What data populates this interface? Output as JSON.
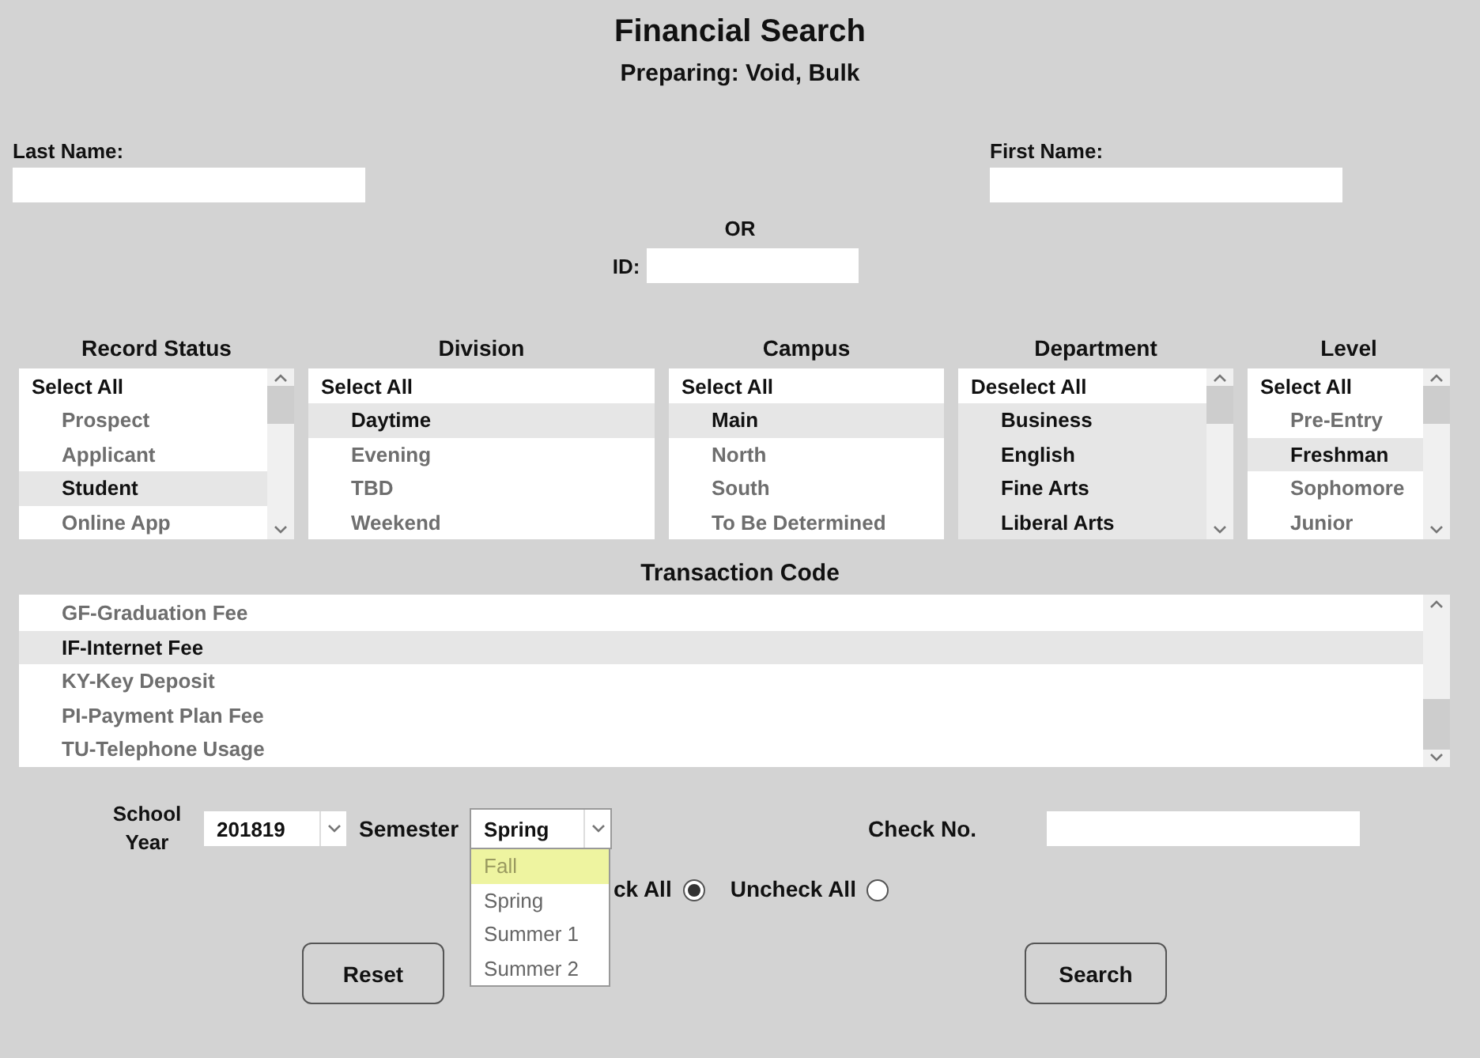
{
  "title": "Financial Search",
  "subtitle": "Preparing: Void, Bulk",
  "last_name": {
    "label": "Last Name:"
  },
  "first_name": {
    "label": "First Name:"
  },
  "or_label": "OR",
  "id_field": {
    "label": "ID:"
  },
  "filters": [
    {
      "heading": "Record Status",
      "header_item": "Select All",
      "scrollbar": true,
      "scrolled_to_end": false,
      "items": [
        {
          "label": "Prospect",
          "selected": false
        },
        {
          "label": "Applicant",
          "selected": false
        },
        {
          "label": "Student",
          "selected": true
        },
        {
          "label": "Online App",
          "selected": false
        }
      ]
    },
    {
      "heading": "Division",
      "header_item": "Select All",
      "items": [
        {
          "label": "Daytime",
          "selected": true
        },
        {
          "label": "Evening",
          "selected": false
        },
        {
          "label": "TBD",
          "selected": false
        },
        {
          "label": "Weekend",
          "selected": false
        }
      ]
    },
    {
      "heading": "Campus",
      "header_item": "Select All",
      "items": [
        {
          "label": "Main",
          "selected": true
        },
        {
          "label": "North",
          "selected": false
        },
        {
          "label": "South",
          "selected": false
        },
        {
          "label": "To Be Determined",
          "selected": false
        }
      ]
    },
    {
      "heading": "Department",
      "header_item": "Deselect All",
      "scrollbar": true,
      "scrolled_to_end": false,
      "items": [
        {
          "label": "Business",
          "selected": true
        },
        {
          "label": "English",
          "selected": true
        },
        {
          "label": "Fine Arts",
          "selected": true
        },
        {
          "label": "Liberal Arts",
          "selected": true
        }
      ]
    },
    {
      "heading": "Level",
      "header_item": "Select All",
      "scrollbar": true,
      "scrolled_to_end": false,
      "items": [
        {
          "label": "Pre-Entry",
          "selected": false
        },
        {
          "label": "Freshman",
          "selected": true
        },
        {
          "label": "Sophomore",
          "selected": false
        },
        {
          "label": "Junior",
          "selected": false
        }
      ]
    }
  ],
  "transaction_code": {
    "heading": "Transaction Code",
    "scrollbar": true,
    "scrolled_to_end": true,
    "items": [
      {
        "label": "GF-Graduation Fee",
        "selected": false
      },
      {
        "label": "IF-Internet Fee",
        "selected": true
      },
      {
        "label": "KY-Key Deposit",
        "selected": false
      },
      {
        "label": "PI-Payment Plan Fee",
        "selected": false
      },
      {
        "label": "TU-Telephone Usage",
        "selected": false
      }
    ]
  },
  "school_year": {
    "label": "School Year",
    "value": "201819"
  },
  "semester": {
    "label": "Semester",
    "value": "Spring",
    "expanded": true,
    "options": [
      {
        "label": "Fall",
        "highlighted": true
      },
      {
        "label": "Spring",
        "highlighted": false
      },
      {
        "label": "Summer 1",
        "highlighted": false
      },
      {
        "label": "Summer 2",
        "highlighted": false
      }
    ]
  },
  "check_no": {
    "label": "Check No."
  },
  "radios": [
    {
      "label": "ck All",
      "selected": true
    },
    {
      "label": "Uncheck All",
      "selected": false
    }
  ],
  "buttons": [
    "Reset",
    "Search"
  ]
}
